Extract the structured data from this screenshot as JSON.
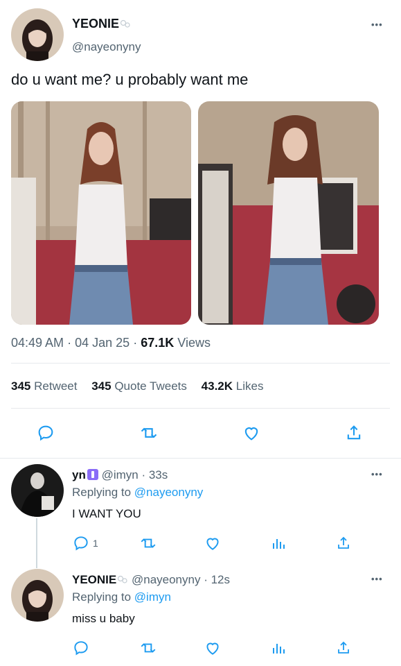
{
  "main_tweet": {
    "display_name": "YEONIE",
    "handle": "@nayeonyny",
    "text": "do u want me? u probably want me",
    "time": "04:49 AM",
    "separator": "·",
    "date": "04 Jan 25",
    "views_count": "67.1K",
    "views_label": "Views",
    "more": "•••"
  },
  "stats": {
    "retweets_count": "345",
    "retweets_label": "Retweet",
    "quotes_count": "345",
    "quotes_label": "Quote Tweets",
    "likes_count": "43.2K",
    "likes_label": "Likes"
  },
  "replies": [
    {
      "display_name": "yn",
      "handle_time": "@imyn · 33s",
      "replying_prefix": "Replying to",
      "replying_to": "@nayeonyny",
      "text": "I WANT YOU",
      "reply_count": "1",
      "more": "•••"
    },
    {
      "display_name": "YEONIE",
      "handle_time": "@nayeonyny · 12s",
      "replying_prefix": "Replying to",
      "replying_to": "@imyn",
      "text": "miss u baby",
      "reply_count": "",
      "more": "•••"
    }
  ],
  "colors": {
    "link": "#1d9bf0",
    "secondary_text": "#536471",
    "primary_text": "#0f1419"
  },
  "icons": [
    "reply-icon",
    "retweet-icon",
    "like-icon",
    "share-icon",
    "analytics-icon",
    "more-icon"
  ]
}
